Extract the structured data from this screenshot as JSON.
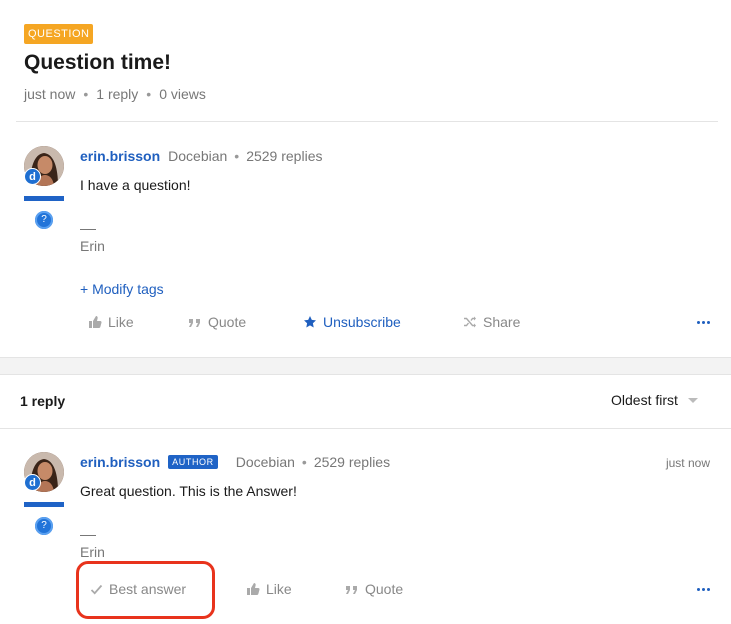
{
  "topic": {
    "badge": "QUESTION",
    "title": "Question time!",
    "posted": "just now",
    "reply_count": "1 reply",
    "views": "0 views"
  },
  "question_post": {
    "author": "erin.brisson",
    "role": "Docebian",
    "author_replies": "2529 replies",
    "body": "I have a question!",
    "signature_dash": "—",
    "signature": "Erin",
    "modify_tags": "+ Modify tags",
    "actions": {
      "like": "Like",
      "quote": "Quote",
      "unsubscribe": "Unsubscribe",
      "share": "Share"
    }
  },
  "replies_header": {
    "count": "1 reply",
    "sort": "Oldest first"
  },
  "reply_post": {
    "author": "erin.brisson",
    "author_badge": "AUTHOR",
    "role": "Docebian",
    "author_replies": "2529 replies",
    "timestamp": "just now",
    "body": "Great question. This is the Answer!",
    "signature_dash": "—",
    "signature": "Erin",
    "actions": {
      "best_answer": "Best answer",
      "like": "Like",
      "quote": "Quote"
    }
  },
  "avatar_initial": "d",
  "rank_icon": "?",
  "colors": {
    "question_badge": "#f5a623",
    "link_blue": "#1f5fbf",
    "highlight_red": "#e8331c"
  }
}
